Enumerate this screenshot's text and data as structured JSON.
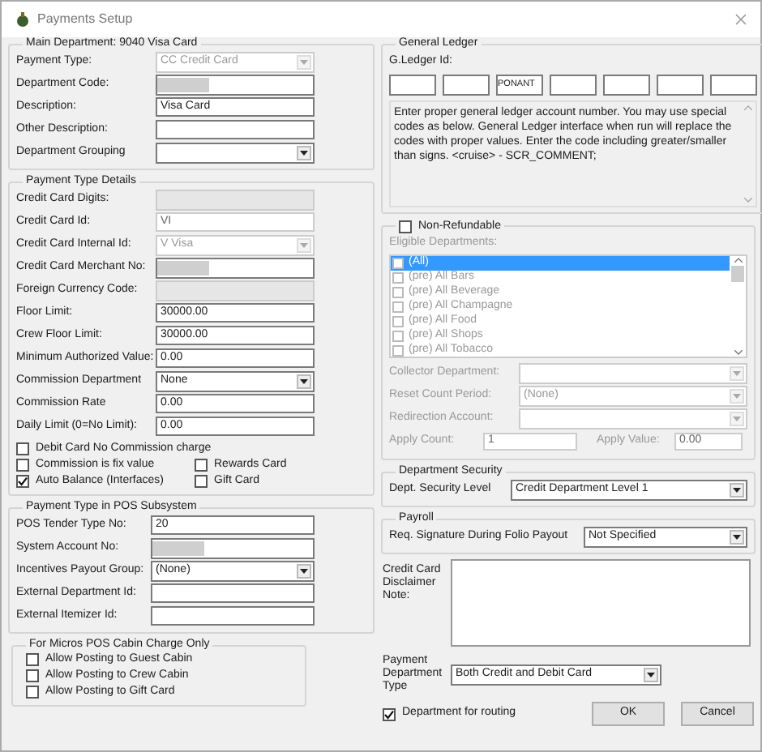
{
  "window": {
    "title": "Payments Setup"
  },
  "main_department": {
    "title": "Main Department: 9040 Visa Card",
    "fields": [
      {
        "label": "Payment Type:",
        "kind": "dropdown",
        "value": "CC Credit Card",
        "disabled": true
      },
      {
        "label": "Department Code:",
        "kind": "redacted"
      },
      {
        "label": "Description:",
        "kind": "text",
        "value": "Visa Card",
        "disabled": false
      },
      {
        "label": "Other Description:",
        "kind": "text",
        "disabled": false
      },
      {
        "label": "Department Grouping",
        "kind": "dropdown",
        "disabled": false
      }
    ]
  },
  "payment_type_details": {
    "title": "Payment Type Details",
    "fields": [
      {
        "label": "Credit Card Digits:",
        "kind": "readonly"
      },
      {
        "label": "Credit Card Id:",
        "kind": "text",
        "value": "VI",
        "disabled": true
      },
      {
        "label": "Credit Card Internal Id:",
        "kind": "dropdown",
        "value": "V Visa",
        "disabled": true
      },
      {
        "label": "Credit Card Merchant No:",
        "kind": "redacted"
      },
      {
        "label": "Foreign Currency Code:",
        "kind": "readonly"
      },
      {
        "label": "Floor Limit:",
        "kind": "text",
        "value": "30000.00",
        "disabled": false
      },
      {
        "label": "Crew Floor Limit:",
        "kind": "text",
        "value": "30000.00",
        "disabled": false
      },
      {
        "label": "Minimum Authorized Value:",
        "kind": "text",
        "value": "0.00",
        "disabled": false
      },
      {
        "label": "Commission Department",
        "kind": "dropdown",
        "value": "None",
        "disabled": false
      },
      {
        "label": "Commission Rate",
        "kind": "text",
        "value": "0.00",
        "disabled": false
      },
      {
        "label": "Daily Limit (0=No Limit):",
        "kind": "text",
        "value": "0.00",
        "disabled": false
      }
    ],
    "checkbox_rows": [
      [
        {
          "label": "Debit Card No Commission charge",
          "checked": false
        }
      ],
      [
        {
          "label": "Commission is fix value",
          "checked": false
        },
        {
          "label": "Rewards Card",
          "checked": false
        }
      ],
      [
        {
          "label": "Auto Balance (Interfaces)",
          "checked": true
        },
        {
          "label": "Gift Card",
          "checked": false
        }
      ]
    ]
  },
  "pos_subsystem": {
    "title": "Payment Type in POS Subsystem",
    "fields": [
      {
        "label": "POS Tender Type No:",
        "kind": "text",
        "value": "20",
        "disabled": false
      },
      {
        "label": "System Account No:",
        "kind": "redacted"
      },
      {
        "label": "Incentives Payout Group:",
        "kind": "dropdown",
        "value": "(None)",
        "disabled": false
      },
      {
        "label": "External Department Id:",
        "kind": "text",
        "disabled": false
      },
      {
        "label": "External Itemizer Id:",
        "kind": "text",
        "disabled": false
      }
    ]
  },
  "micros_cabin_charge": {
    "title": "For Micros POS Cabin Charge Only",
    "checkboxes": [
      {
        "label": "Allow Posting to Guest Cabin",
        "checked": false
      },
      {
        "label": "Allow Posting to Crew Cabin",
        "checked": false
      },
      {
        "label": "Allow Posting to Gift Card",
        "checked": false
      }
    ]
  },
  "general_ledger": {
    "title": "General Ledger",
    "label": "G.Ledger Id:",
    "segments": [
      {
        "kind": "empty"
      },
      {
        "kind": "empty"
      },
      {
        "kind": "text",
        "value": "PONANT"
      },
      {
        "kind": "empty"
      },
      {
        "kind": "empty"
      },
      {
        "kind": "empty"
      },
      {
        "kind": "empty"
      }
    ],
    "note": "Enter proper general ledger account number. You may use special codes as below. General Ledger interface when run will replace the codes with proper values. Enter the code including greater/smaller than signs. <cruise> - SCR_COMMENT;"
  },
  "non_refundable": {
    "label": "Non-Refundable",
    "checked": false,
    "eligible_label": "Eligible Departments:",
    "departments": [
      {
        "label": "(All)",
        "checked": false,
        "selected": true
      },
      {
        "label": "(pre) All Bars",
        "checked": false,
        "selected": false
      },
      {
        "label": "(pre) All Beverage",
        "checked": false,
        "selected": false
      },
      {
        "label": "(pre) All Champagne",
        "checked": false,
        "selected": false
      },
      {
        "label": "(pre) All Food",
        "checked": false,
        "selected": false
      },
      {
        "label": "(pre) All Shops",
        "checked": false,
        "selected": false
      },
      {
        "label": "(pre) All Tobacco",
        "checked": false,
        "selected": false
      }
    ],
    "fields": [
      {
        "label": "Collector Department:",
        "kind": "dropdown",
        "disabled": true
      },
      {
        "label": "Reset Count Period:",
        "kind": "dropdown",
        "value": "(None)",
        "disabled": true
      },
      {
        "label": "Redirection Account:",
        "kind": "dropdown",
        "disabled": true
      }
    ],
    "apply_count": {
      "label": "Apply Count:",
      "value": "1"
    },
    "apply_value": {
      "label": "Apply Value:",
      "value": "0.00"
    }
  },
  "department_security": {
    "title": "Department Security",
    "label": "Dept. Security Level",
    "value": "Credit Department Level 1"
  },
  "payroll": {
    "title": "Payroll",
    "label": "Req. Signature During Folio Payout",
    "value": "Not Specified"
  },
  "disclaimer": {
    "label": "Credit Card Disclaimer Note:"
  },
  "payment_department_type": {
    "label": "Payment Department Type",
    "value": "Both Credit and Debit Card"
  },
  "routing": {
    "label": "Department for routing",
    "checked": true
  },
  "buttons": [
    "OK",
    "Cancel"
  ]
}
